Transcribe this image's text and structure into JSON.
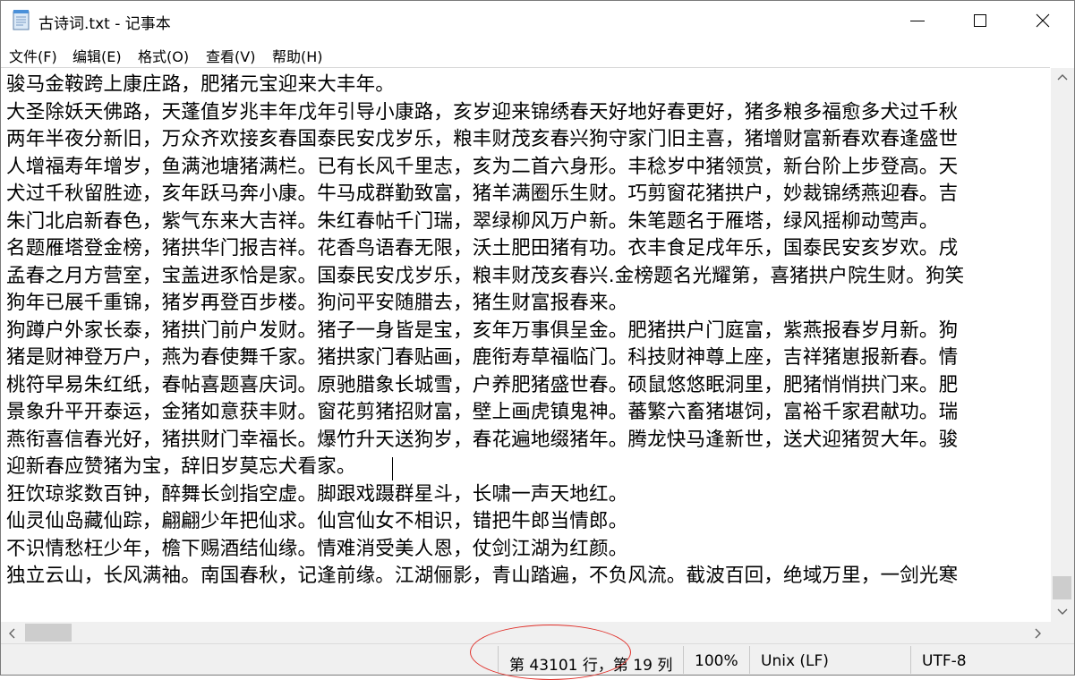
{
  "window": {
    "title": "古诗词.txt - 记事本"
  },
  "menu": [
    "文件(F)",
    "编辑(E)",
    "格式(O)",
    "查看(V)",
    "帮助(H)"
  ],
  "editor": {
    "lines": [
      "骏马金鞍跨上康庄路，肥猪元宝迎来大丰年。",
      "大圣除妖天佛路，天蓬值岁兆丰年戊年引导小康路，亥岁迎来锦绣春天好地好春更好，猪多粮多福愈多犬过千秋",
      "两年半夜分新旧，万众齐欢接亥春国泰民安戊岁乐，粮丰财茂亥春兴狗守家门旧主喜，猪增财富新春欢春逢盛世",
      "人增福寿年增岁，鱼满池塘猪满栏。已有长风千里志，亥为二首六身形。丰稔岁中猪领赏，新台阶上步登高。天",
      "犬过千秋留胜迹，亥年跃马奔小康。牛马成群勤致富，猪羊满圈乐生财。巧剪窗花猪拱户，妙裁锦绣燕迎春。吉",
      "朱门北启新春色，紫气东来大吉祥。朱红春帖千门瑞，翠绿柳风万户新。朱笔题名于雁塔，绿风摇柳动莺声。",
      "名题雁塔登金榜，猪拱华门报吉祥。花香鸟语春无限，沃土肥田猪有功。衣丰食足戌年乐，国泰民安亥岁欢。戌",
      "孟春之月方营室，宝盖进豕恰是家。国泰民安戊岁乐，粮丰财茂亥春兴.金榜题名光耀第，喜猪拱户院生财。狗笑",
      "狗年已展千重锦，猪岁再登百步楼。狗问平安随腊去，猪生财富报春来。",
      "狗蹲户外家长泰，猪拱门前户发财。猪子一身皆是宝，亥年万事俱呈金。肥猪拱户门庭富，紫燕报春岁月新。狗",
      "猪是财神登万户，燕为春使舞千家。猪拱家门春贴画，鹿衔寿草福临门。科技财神尊上座，吉祥猪崽报新春。情",
      "桃符早易朱红纸，春帖喜题喜庆词。原驰腊象长城雪，户养肥猪盛世春。硕鼠悠悠眠洞里，肥猪悄悄拱门来。肥",
      "景象升平开泰运，金猪如意获丰财。窗花剪猪招财富，壁上画虎镇鬼神。蕃繁六畜猪堪饲，富裕千家君献功。瑞",
      "燕衔喜信春光好，猪拱财门幸福长。爆竹升天送狗岁，春花遍地缀猪年。腾龙快马逢新世，送犬迎猪贺大年。骏",
      "迎新春应赞猪为宝，辞旧岁莫忘犬看家。",
      "狂饮琼浆数百钟，醉舞长剑指空虚。脚跟戏蹑群星斗，长啸一声天地红。",
      "仙灵仙岛藏仙踪，翩翩少年把仙求。仙宫仙女不相识，错把牛郎当情郎。",
      "不识情愁枉少年，檐下赐酒结仙缘。情难消受美人恩，仗剑江湖为红颜。",
      "独立云山，长风满袖。南国春秋，记逢前缘。江湖俪影，青山踏遍，不负风流。截波百回，绝域万里，一剑光寒"
    ]
  },
  "status": {
    "position": "第 43101 行，第 19 列",
    "zoom": "100%",
    "line_ending": "Unix (LF)",
    "encoding": "UTF-8"
  },
  "colors": {
    "annotation": "#e0302a",
    "statusbar": "#f0f0f0"
  },
  "icons": [
    "notepad-icon",
    "minimize-icon",
    "maximize-icon",
    "close-icon",
    "scroll-up-icon",
    "scroll-down-icon",
    "scroll-left-icon",
    "scroll-right-icon"
  ]
}
